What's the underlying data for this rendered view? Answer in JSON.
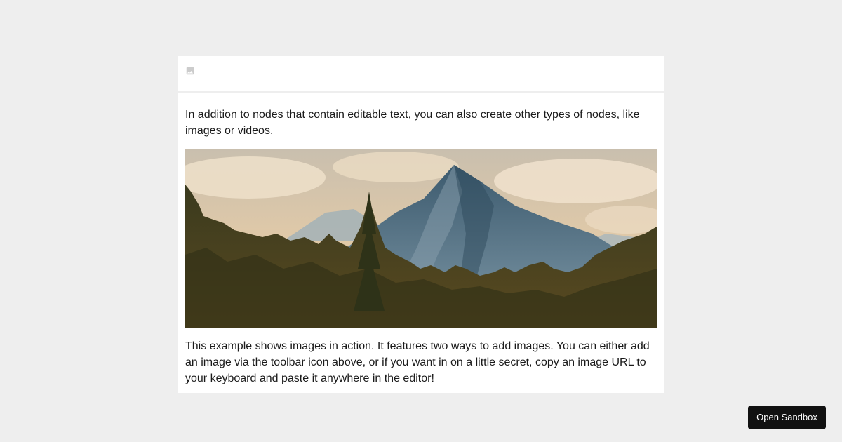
{
  "toolbar": {
    "image_button_icon": "image-icon"
  },
  "content": {
    "paragraph_1": "In addition to nodes that contain editable text, you can also create other types of nodes, like images or videos.",
    "image_icon_name": "mountain-landscape-image",
    "paragraph_2": "This example shows images in action. It features two ways to add images. You can either add an image via the toolbar icon above, or if you want in on a little secret, copy an image URL to your keyboard and paste it anywhere in the editor!"
  },
  "sandbox": {
    "label": "Open Sandbox"
  },
  "colors": {
    "page_background": "#eeeeee",
    "editor_background": "#ffffff",
    "button_background": "#111111",
    "icon_gray": "#cccccc"
  }
}
